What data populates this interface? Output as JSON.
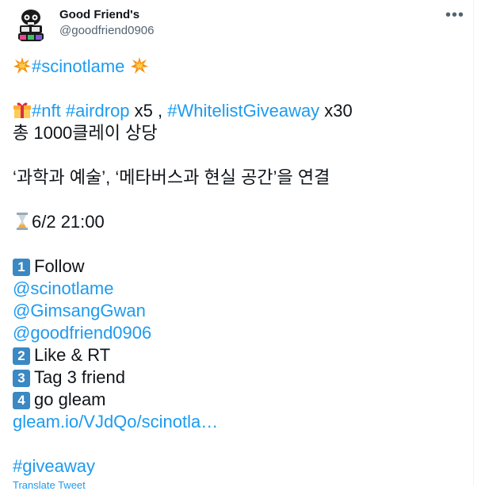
{
  "author": {
    "name": "Good Friend's",
    "handle": "@goodfriend0906"
  },
  "tweet": {
    "line1_hashtag": "#scinotlame",
    "line2_hashtag_nft": "#nft",
    "line2_hashtag_airdrop": "#airdrop",
    "line2_x5": " x5 , ",
    "line2_hashtag_whitelist": "#WhitelistGiveaway",
    "line2_x30": "  x30",
    "line3": "총 1000클레이 상당",
    "line4": "‘과학과 예술’, ‘메타버스과 현실 공간’을 연결",
    "deadline": "6/2 21:00",
    "step1_key": "1",
    "step1": "Follow",
    "mention1": "@scinotlame",
    "mention2": "@GimsangGwan",
    "mention3": "@goodfriend0906",
    "step2_key": "2",
    "step2": "Like & RT",
    "step3_key": "3",
    "step3": "Tag 3 friend",
    "step4_key": "4",
    "step4": "go gleam",
    "link": "gleam.io/VJdQo/scinotla…",
    "hashtag_giveaway": "#giveaway"
  },
  "translate_label": "Translate Tweet",
  "icons": {
    "more": "more-icon",
    "collision": "collision-emoji",
    "gift": "gift-emoji",
    "hourglass": "hourglass-emoji"
  },
  "colors": {
    "link": "#1d9bf0",
    "text": "#0f1419",
    "secondary": "#536471",
    "keycap": "#3b88c3"
  }
}
